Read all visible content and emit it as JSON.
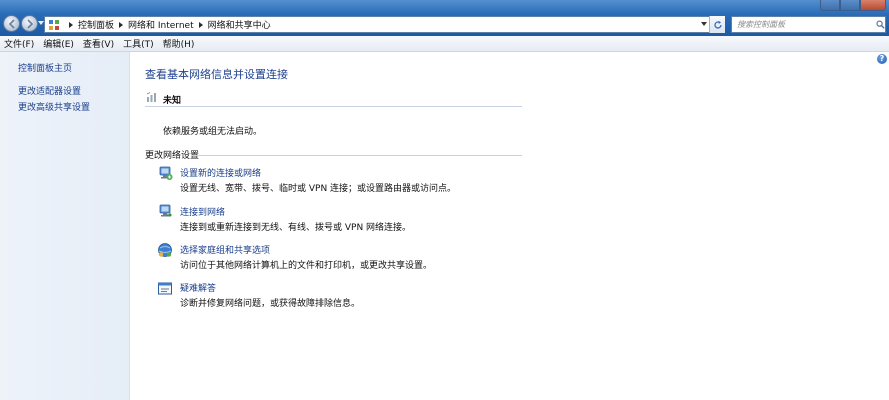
{
  "address_bar": {
    "breadcrumbs": [
      "控制面板",
      "网络和 Internet",
      "网络和共享中心"
    ]
  },
  "search": {
    "placeholder": "搜索控制面板"
  },
  "menu": [
    "文件(F)",
    "编辑(E)",
    "查看(V)",
    "工具(T)",
    "帮助(H)"
  ],
  "sidebar": {
    "items": [
      {
        "label": "控制面板主页"
      },
      {
        "label": "更改适配器设置"
      },
      {
        "label": "更改高级共享设置"
      }
    ]
  },
  "main": {
    "title": "查看基本网络信息并设置连接",
    "network": {
      "name": "未知",
      "status": "依赖服务或组无法启动。"
    },
    "section_title": "更改网络设置",
    "tasks": [
      {
        "link": "设置新的连接或网络",
        "desc": "设置无线、宽带、拨号、临时或 VPN 连接；或设置路由器或访问点。",
        "icon": "new-connection-icon"
      },
      {
        "link": "连接到网络",
        "desc": "连接到或重新连接到无线、有线、拨号或 VPN 网络连接。",
        "icon": "connect-network-icon"
      },
      {
        "link": "选择家庭组和共享选项",
        "desc": "访问位于其他网络计算机上的文件和打印机，或更改共享设置。",
        "icon": "homegroup-icon"
      },
      {
        "link": "疑难解答",
        "desc": "诊断并修复网络问题，或获得故障排除信息。",
        "icon": "troubleshoot-icon"
      }
    ]
  },
  "colors": {
    "titlebar": "#2a6db8",
    "link": "#1a3e8c",
    "title": "#1e3f8f",
    "sidebar_bg": "#eef3fa"
  }
}
